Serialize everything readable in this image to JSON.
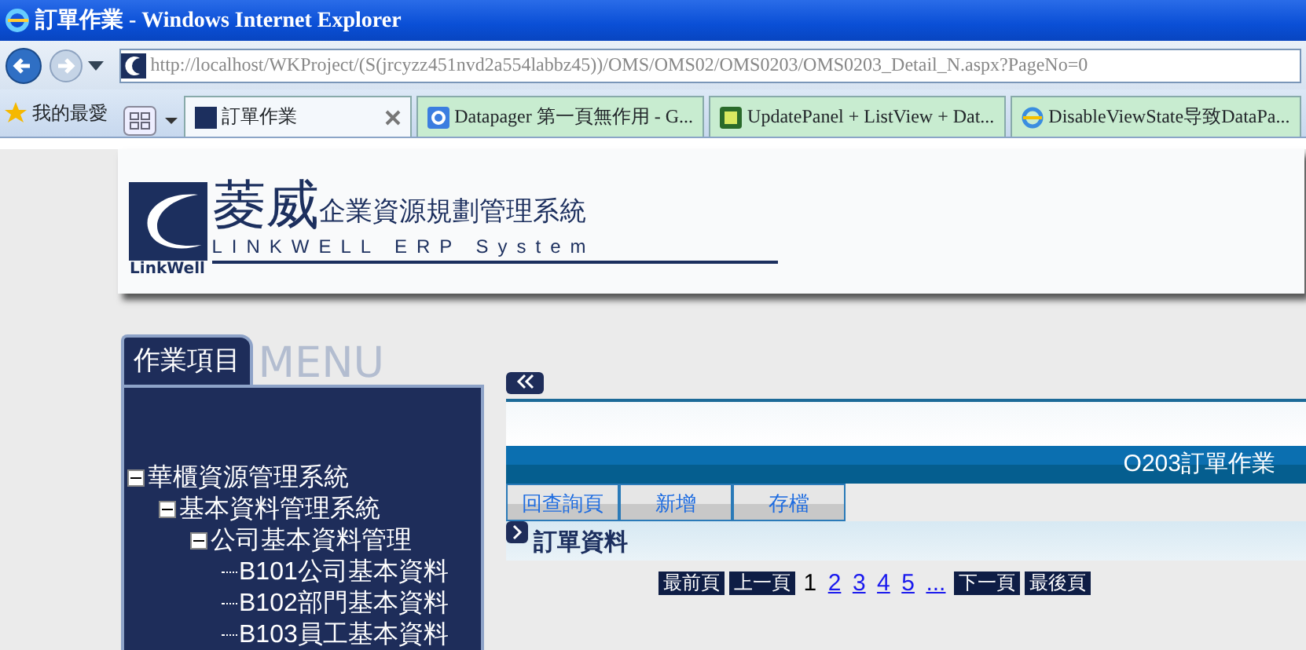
{
  "window": {
    "title": "訂單作業 - Windows Internet Explorer"
  },
  "address": "http://localhost/WKProject/(S(jrcyzz451nvd2a554labbz45))/OMS/OMS02/OMS0203/OMS0203_Detail_N.aspx?PageNo=0",
  "favorites": "我的最愛",
  "tabs": [
    {
      "label": "訂單作業",
      "selected": true
    },
    {
      "label": "Datapager 第一頁無作用 - G...",
      "selected": false
    },
    {
      "label": "UpdatePanel + ListView + Dat...",
      "selected": false
    },
    {
      "label": "DisableViewState导致DataPa...",
      "selected": false
    }
  ],
  "header": {
    "brand": "菱威",
    "subtitle": "企業資源規劃管理系統",
    "english": "LINKWELL ERP System",
    "logo_text": "LinkWell"
  },
  "sidebar": {
    "tab": "作業項目",
    "watermark": "MENU",
    "tree": [
      {
        "label": "華櫃資源管理系統",
        "expanded": true,
        "children": [
          {
            "label": "基本資料管理系統",
            "expanded": true,
            "children": [
              {
                "label": "公司基本資料管理",
                "expanded": true,
                "children": [
                  {
                    "label": "B101公司基本資料"
                  },
                  {
                    "label": "B102部門基本資料"
                  },
                  {
                    "label": "B103員工基本資料"
                  }
                ]
              }
            ]
          }
        ]
      }
    ]
  },
  "main": {
    "page_title": "O203訂單作業",
    "buttons": [
      "回查詢頁",
      "新增",
      "存檔"
    ],
    "section": "訂單資料",
    "pager": {
      "first": "最前頁",
      "prev": "上一頁",
      "pages": [
        {
          "label": "1",
          "selected": true
        },
        {
          "label": "2",
          "selected": false
        },
        {
          "label": "3",
          "selected": false
        },
        {
          "label": "4",
          "selected": false
        },
        {
          "label": "5",
          "selected": false
        },
        {
          "label": "...",
          "selected": false
        }
      ],
      "next": "下一頁",
      "last": "最後頁"
    }
  }
}
